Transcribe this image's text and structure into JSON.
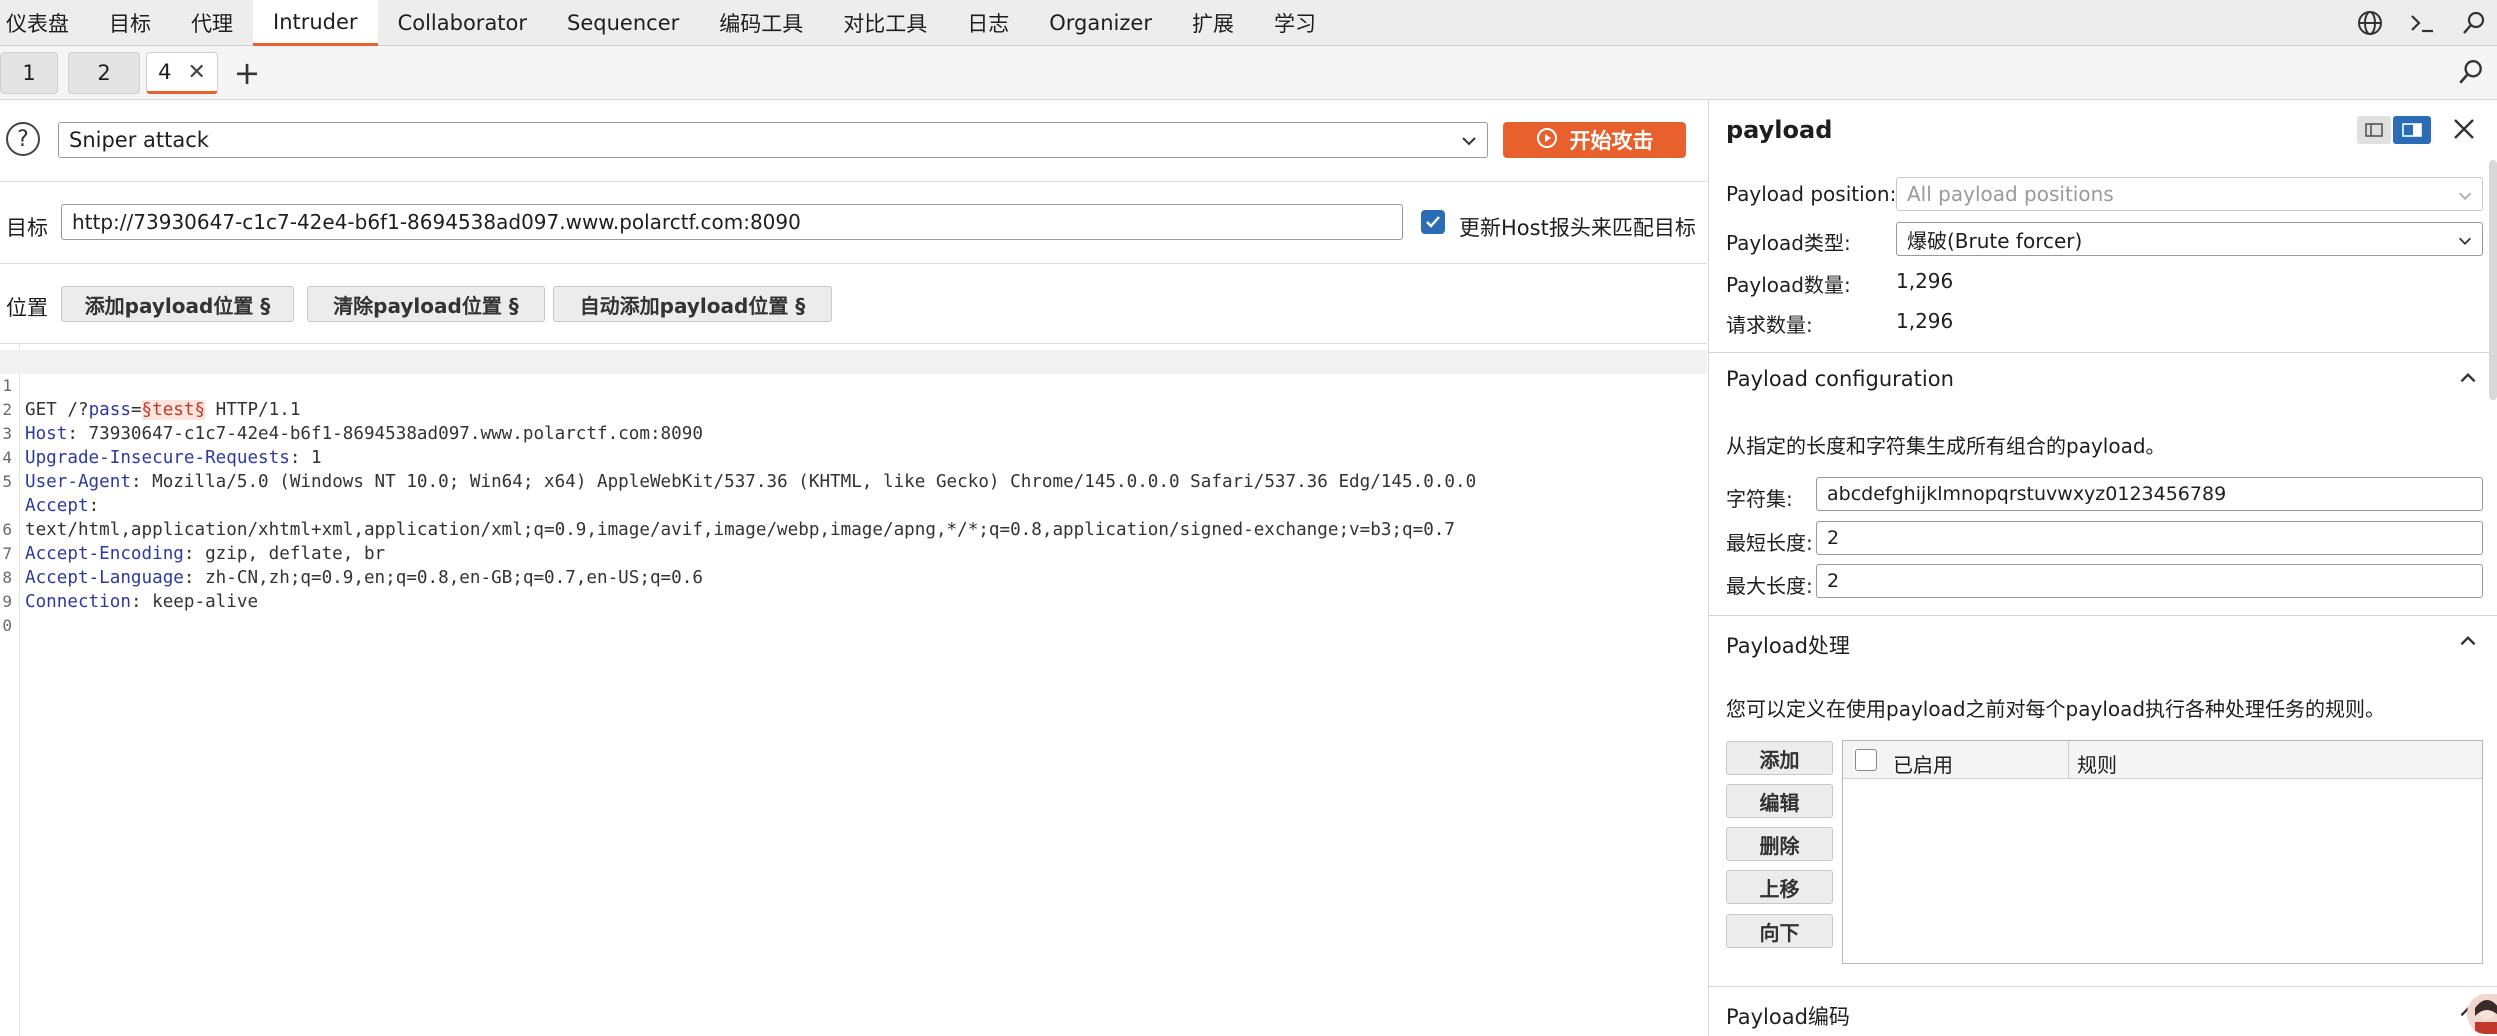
{
  "menu": {
    "items": [
      "仪表盘",
      "目标",
      "代理",
      "Intruder",
      "Collaborator",
      "Sequencer",
      "编码工具",
      "对比工具",
      "日志",
      "Organizer",
      "扩展",
      "学习"
    ],
    "active_index": 3,
    "icons": [
      "globe-icon",
      "terminal-icon",
      "search-icon"
    ]
  },
  "tabs": {
    "items": [
      "1",
      "2",
      "4"
    ],
    "active_index": 2,
    "add_label": "+"
  },
  "attack": {
    "help_label": "?",
    "type": "Sniper attack",
    "start_label": "开始攻击"
  },
  "target": {
    "label": "目标",
    "url": "http://73930647-c1c7-42e4-b6f1-8694538ad097.www.polarctf.com:8090",
    "update_host_checked": true,
    "update_host_label": "更新Host报头来匹配目标"
  },
  "positions": {
    "label": "位置",
    "add_label": "添加payload位置 §",
    "clear_label": "清除payload位置 §",
    "auto_label": "自动添加payload位置 §"
  },
  "request": {
    "line_numbers": [
      "1",
      "2",
      "3",
      "4",
      "5",
      "",
      "6",
      "7",
      "8",
      "9",
      "0"
    ],
    "l1_method": "GET /?",
    "l1_param": "pass",
    "l1_eq": "=",
    "l1_payload": "§test§",
    "l1_rest": " HTTP/1.1",
    "l2_key": "Host",
    "l2_val": ": 73930647-c1c7-42e4-b6f1-8694538ad097.www.polarctf.com:8090",
    "l3_key": "Upgrade-Insecure-Requests",
    "l3_val": ": 1",
    "l4_key": "User-Agent",
    "l4_val": ": Mozilla/5.0 (Windows NT 10.0; Win64; x64) AppleWebKit/537.36 (KHTML, like Gecko) Chrome/145.0.0.0 Safari/537.36 Edg/145.0.0.0",
    "l5_key": "Accept",
    "l5_val": ":",
    "l5b_val": "text/html,application/xhtml+xml,application/xml;q=0.9,image/avif,image/webp,image/apng,*/*;q=0.8,application/signed-exchange;v=b3;q=0.7",
    "l6_key": "Accept-Encoding",
    "l6_val": ": gzip, deflate, br",
    "l7_key": "Accept-Language",
    "l7_val": ": zh-CN,zh;q=0.9,en;q=0.8,en-GB;q=0.7,en-US;q=0.6",
    "l8_key": "Connection",
    "l8_val": ": keep-alive"
  },
  "payload_panel": {
    "title": "payload",
    "position_label": "Payload position:",
    "position_value": "All payload positions",
    "type_label": "Payload类型:",
    "type_value": "爆破(Brute forcer)",
    "count_label": "Payload数量:",
    "count_value": "1,296",
    "request_label": "请求数量:",
    "request_value": "1,296"
  },
  "config": {
    "title": "Payload configuration",
    "description": "从指定的长度和字符集生成所有组合的payload。",
    "charset_label": "字符集:",
    "charset_value": "abcdefghijklmnopqrstuvwxyz0123456789",
    "min_label": "最短长度:",
    "min_value": "2",
    "max_label": "最大长度:",
    "max_value": "2"
  },
  "processing": {
    "title": "Payload处理",
    "description": "您可以定义在使用payload之前对每个payload执行各种处理任务的规则。",
    "buttons": [
      "添加",
      "编辑",
      "删除",
      "上移",
      "向下"
    ],
    "col_enabled": "已启用",
    "col_rule": "规则"
  },
  "encoding": {
    "title": "Payload编码"
  },
  "colors": {
    "accent": "#e8612c",
    "checkbox": "#2a6db5",
    "header_key": "#2f3aa0",
    "payload_marker": "#c0392b"
  }
}
